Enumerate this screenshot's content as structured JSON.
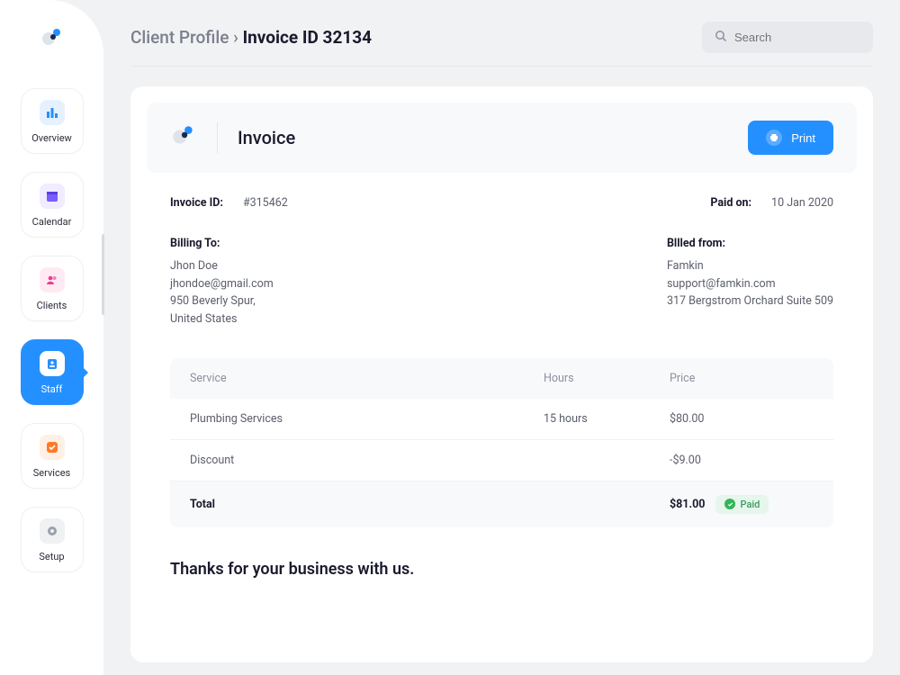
{
  "sidebar": {
    "items": [
      {
        "label": "Overview",
        "icon": "bar-chart"
      },
      {
        "label": "Calendar",
        "icon": "calendar"
      },
      {
        "label": "Clients",
        "icon": "people"
      },
      {
        "label": "Staff",
        "icon": "badge",
        "active": true
      },
      {
        "label": "Services",
        "icon": "check"
      },
      {
        "label": "Setup",
        "icon": "gear"
      }
    ]
  },
  "header": {
    "breadcrumb_parent": "Client Profile",
    "breadcrumb_current": "Invoice ID 32134",
    "search_placeholder": "Search"
  },
  "invoice": {
    "card_title": "Invoice",
    "print_label": "Print",
    "id_label": "Invoice ID:",
    "id_value": "#315462",
    "paid_on_label": "Paid on:",
    "paid_on_value": "10 Jan 2020",
    "billing_to_label": "Billing To:",
    "billing_to": {
      "name": "Jhon Doe",
      "email": "jhondoe@gmail.com",
      "street": "950 Beverly Spur,",
      "country": "United States"
    },
    "billed_from_label": "Bllled from:",
    "billed_from": {
      "name": "Famkin",
      "email": "support@famkin.com",
      "street": "317 Bergstrom Orchard Suite 509"
    },
    "table": {
      "head": {
        "service": "Service",
        "hours": "Hours",
        "price": "Price"
      },
      "rows": [
        {
          "service": "Plumbing Services",
          "hours": "15 hours",
          "price": "$80.00"
        },
        {
          "service": "Discount",
          "hours": "",
          "price": "-$9.00"
        }
      ],
      "total_label": "Total",
      "total_price": "$81.00",
      "paid_badge": "Paid"
    },
    "thanks": "Thanks for your business with us."
  }
}
